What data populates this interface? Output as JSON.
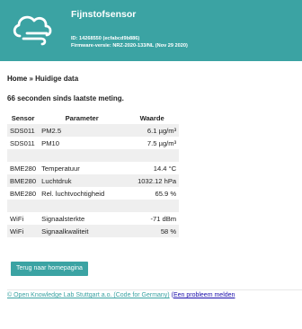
{
  "header": {
    "title": "Fijnstofsensor",
    "id_line": "ID: 14268550 (ecfabcd9b886)",
    "firmware_line": "Firmware-versie: NRZ-2020-133/NL (Nov 29 2020)",
    "logo_icon": "cloud-wind-icon"
  },
  "breadcrumb": {
    "home": "Home",
    "sep": " » ",
    "current": "Huidige data"
  },
  "status": "66 seconden sinds laatste meting.",
  "table": {
    "headers": [
      "Sensor",
      "Parameter",
      "Waarde"
    ],
    "rows": [
      {
        "sensor": "SDS011",
        "param": "PM2.5",
        "value": "6.1 µg/m³"
      },
      {
        "sensor": "SDS011",
        "param": "PM10",
        "value": "7.5 µg/m³"
      },
      {
        "sensor": "",
        "param": "",
        "value": ""
      },
      {
        "sensor": "BME280",
        "param": "Temperatuur",
        "value": "14.4 °C"
      },
      {
        "sensor": "BME280",
        "param": "Luchtdruk",
        "value": "1032.12 hPa"
      },
      {
        "sensor": "BME280",
        "param": "Rel. luchtvochtigheid",
        "value": "65.9 %"
      },
      {
        "sensor": "",
        "param": "",
        "value": ""
      },
      {
        "sensor": "WiFi",
        "param": "Signaalsterkte",
        "value": "-71 dBm"
      },
      {
        "sensor": "WiFi",
        "param": "Signaalkwaliteit",
        "value": "58 %"
      }
    ]
  },
  "home_button": "Terug naar homepagina",
  "footer": {
    "credit": "© Open Knowledge Lab Stuttgart a.o. (Code for Germany)",
    "report_open": "(",
    "report": "Een probleem melden"
  },
  "colors": {
    "accent": "#3ba3a3",
    "link": "#1a0dab"
  }
}
